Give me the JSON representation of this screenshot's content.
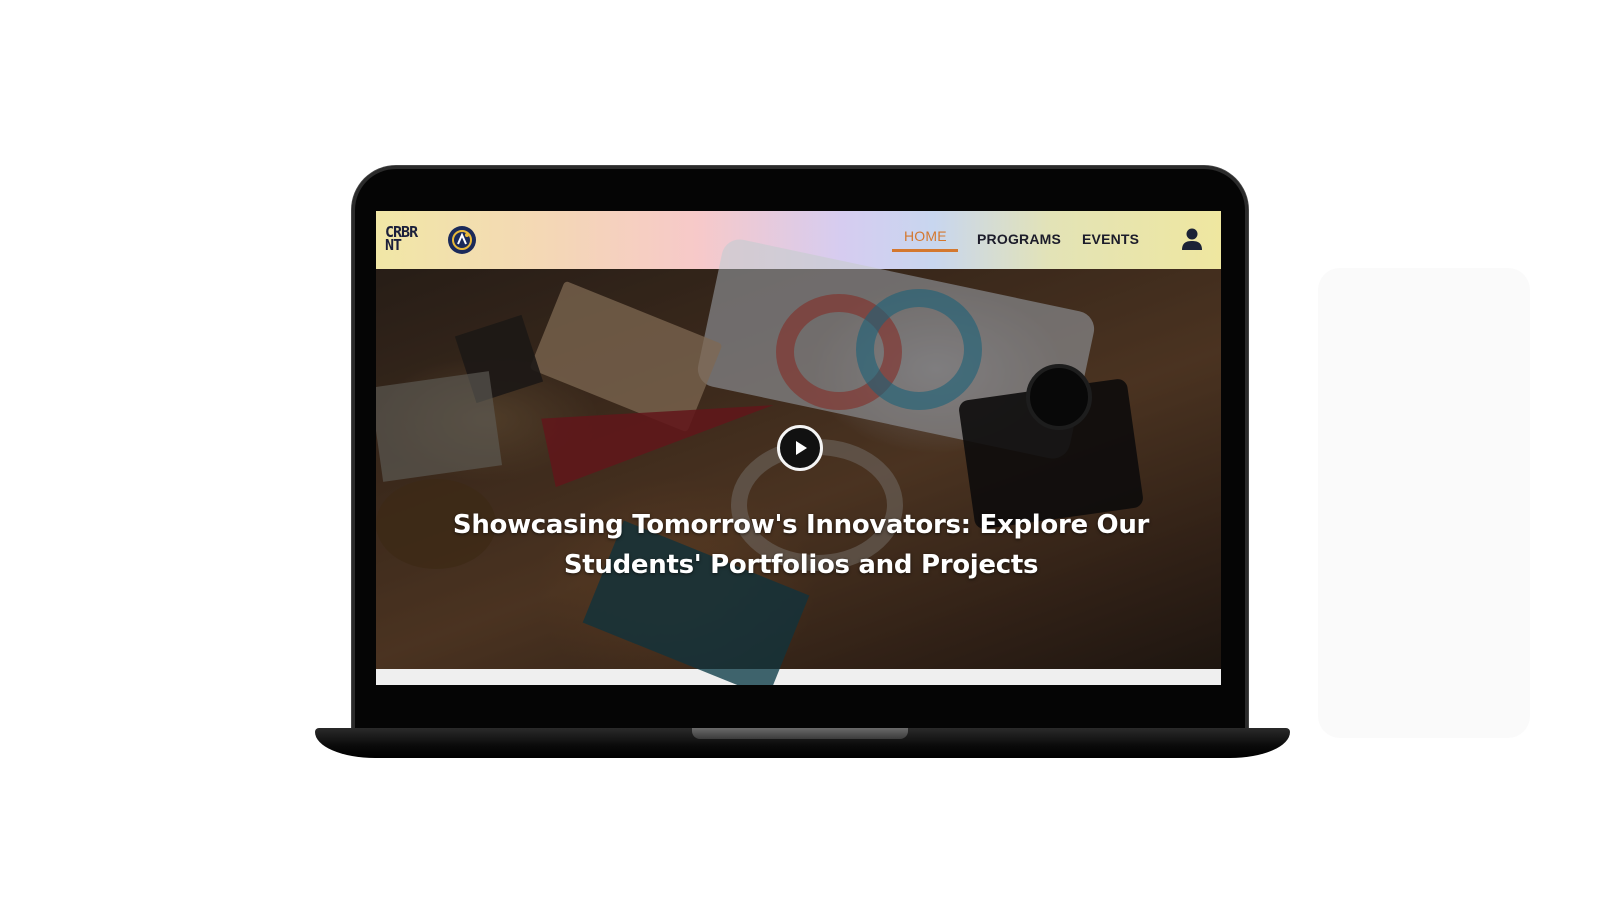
{
  "navbar": {
    "logo_text_top": "CRBR",
    "logo_text_bottom": "NT",
    "items": [
      {
        "label": "HOME",
        "active": true
      },
      {
        "label": "PROGRAMS",
        "active": false
      },
      {
        "label": "EVENTS",
        "active": false
      }
    ],
    "user_icon": "user-icon",
    "active_color": "#d4782f"
  },
  "hero": {
    "title": "Showcasing Tomorrow's Innovators: Explore Our Students' Portfolios and Projects",
    "play_icon": "play-icon"
  }
}
